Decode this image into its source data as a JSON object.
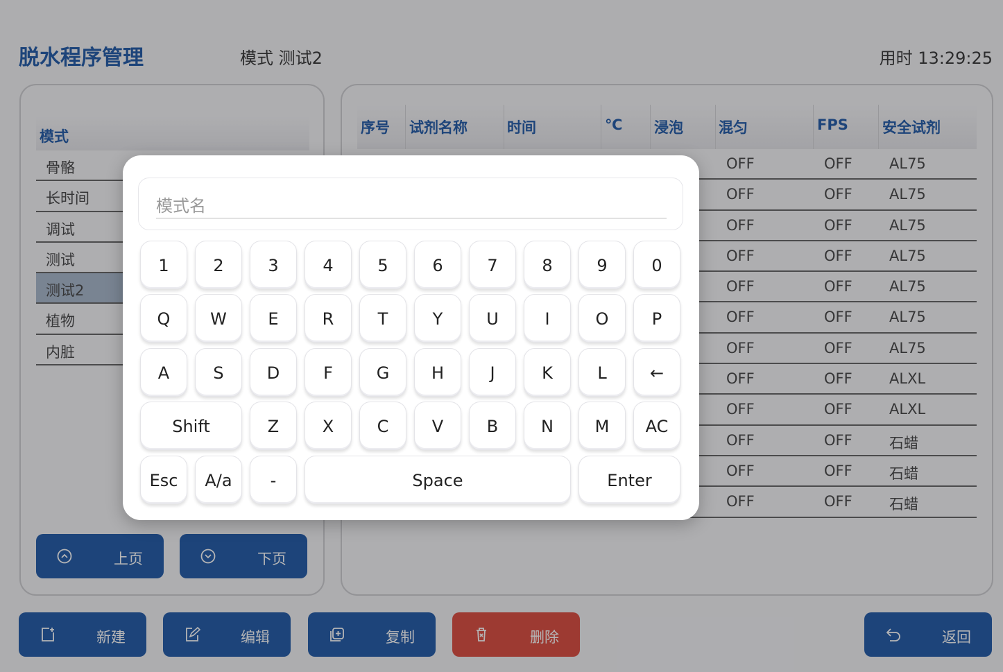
{
  "header": {
    "app_title": "脱水程序管理",
    "mode_label": "模式 测试2",
    "elapsed": "用时 13:29:25"
  },
  "mode_panel": {
    "column_header": "模式",
    "items": [
      {
        "label": "骨骼"
      },
      {
        "label": "长时间"
      },
      {
        "label": "调试"
      },
      {
        "label": "测试"
      },
      {
        "label": "测试2",
        "selected": true
      },
      {
        "label": "植物"
      },
      {
        "label": "内脏"
      }
    ],
    "prev_label": "上页",
    "next_label": "下页"
  },
  "program_table": {
    "columns": [
      "序号",
      "试剂名称",
      "时间",
      "℃",
      "浸泡",
      "混匀",
      "FPS",
      "安全试剂"
    ],
    "rows": [
      {
        "mix": "OFF",
        "fps": "OFF",
        "safe": "AL75"
      },
      {
        "mix": "OFF",
        "fps": "OFF",
        "safe": "AL75"
      },
      {
        "mix": "OFF",
        "fps": "OFF",
        "safe": "AL75"
      },
      {
        "mix": "OFF",
        "fps": "OFF",
        "safe": "AL75"
      },
      {
        "mix": "OFF",
        "fps": "OFF",
        "safe": "AL75"
      },
      {
        "mix": "OFF",
        "fps": "OFF",
        "safe": "AL75"
      },
      {
        "mix": "OFF",
        "fps": "OFF",
        "safe": "AL75"
      },
      {
        "mix": "OFF",
        "fps": "OFF",
        "safe": "ALXL"
      },
      {
        "mix": "OFF",
        "fps": "OFF",
        "safe": "ALXL"
      },
      {
        "mix": "OFF",
        "fps": "OFF",
        "safe": "石蜡"
      },
      {
        "mix": "OFF",
        "fps": "OFF",
        "safe": "石蜡"
      },
      {
        "mix": "OFF",
        "fps": "OFF",
        "safe": "石蜡"
      }
    ]
  },
  "actions": {
    "new": "新建",
    "edit": "编辑",
    "copy": "复制",
    "delete": "删除",
    "back": "返回"
  },
  "keyboard": {
    "input_value": "",
    "input_placeholder": "模式名",
    "rows": [
      [
        "1",
        "2",
        "3",
        "4",
        "5",
        "6",
        "7",
        "8",
        "9",
        "0"
      ],
      [
        "Q",
        "W",
        "E",
        "R",
        "T",
        "Y",
        "U",
        "I",
        "O",
        "P"
      ],
      [
        "A",
        "S",
        "D",
        "F",
        "G",
        "H",
        "J",
        "K",
        "L",
        "←"
      ],
      [
        "Shift",
        "Z",
        "X",
        "C",
        "V",
        "B",
        "N",
        "M",
        "AC"
      ],
      [
        "Esc",
        "A/a",
        "-",
        "Space",
        "Enter"
      ]
    ]
  },
  "colors": {
    "primary": "#0a4a9e",
    "danger": "#d9392b",
    "selected_row": "#9fb1c6"
  }
}
